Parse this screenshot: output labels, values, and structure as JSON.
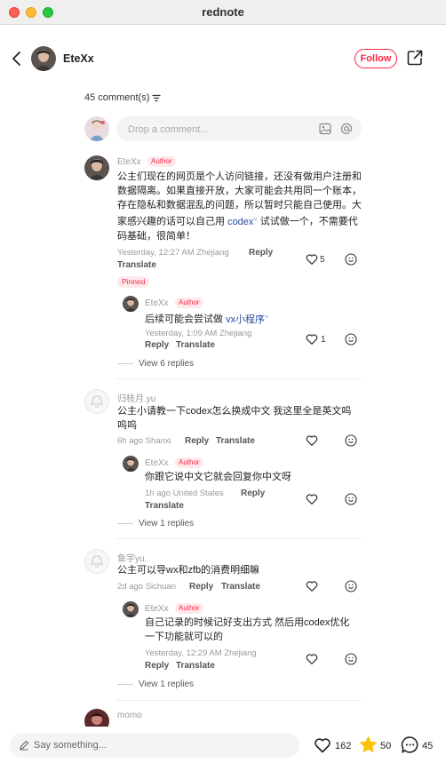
{
  "window": {
    "title": "rednote"
  },
  "nav": {
    "author_name": "EteXx",
    "follow_label": "Follow"
  },
  "comments_header": {
    "count_label": "45 comment(s)",
    "input_placeholder": "Drop a comment..."
  },
  "comments": [
    {
      "user": "EteXx",
      "badge": "Author",
      "text_lines": [
        "公主们现在的网页是个人访问链接，还没有做用户注册和",
        "数据隔离。如果直接开放，大家可能会共用同一个账本，",
        "存在隐私和数据混乱的问题，所以暂时只能自己使用。大",
        "家感兴趣的话可以自己用 ",
        "codex",
        " 试试做一个，不需要代",
        "码基础，很简单！"
      ],
      "meta": "Yesterday, 12:27 AM Zhejiang",
      "reply_label": "Reply",
      "translate_label": "Translate",
      "likes": "5",
      "pinned_label": "Pinned",
      "reply": {
        "user": "EteXx",
        "badge": "Author",
        "text_prefix": "后续可能会尝试做 ",
        "text_tag": "vx小程序",
        "meta": "Yesterday, 1:09 AM Zhejiang",
        "reply_label": "Reply",
        "translate_label": "Translate",
        "likes": "1"
      },
      "view_replies": "View 6 replies"
    },
    {
      "user": "归枝月.yu",
      "text_lines": [
        "公主小请教一下codex怎么换成中文 我这里全是英文呜",
        "呜呜"
      ],
      "meta": "6h ago Shanxi",
      "reply_label": "Reply",
      "translate_label": "Translate",
      "reply": {
        "user": "EteXx",
        "badge": "Author",
        "text": "你跟它说中文它就会回复你中文呀",
        "meta": "1h ago United States",
        "reply_label": "Reply",
        "translate_label": "Translate"
      },
      "view_replies": "View 1 replies"
    },
    {
      "user": "鱼宇yu.",
      "text": "公主可以导wx和zfb的消费明细嘛",
      "meta": "2d ago Sichuan",
      "reply_label": "Reply",
      "translate_label": "Translate",
      "reply": {
        "user": "EteXx",
        "badge": "Author",
        "text_lines": [
          "自己记录的时候记好支出方式 然后用codex优化",
          "一下功能就可以的"
        ],
        "meta": "Yesterday, 12:29 AM Zhejiang",
        "reply_label": "Reply",
        "translate_label": "Translate"
      },
      "view_replies": "View 1 replies"
    },
    {
      "user": "momo"
    }
  ],
  "bottom": {
    "input_placeholder": "Say something...",
    "likes": "162",
    "stars": "50",
    "comments": "45"
  },
  "colors": {
    "accent": "#ff2442",
    "tag": "#2c4aa0",
    "star": "#ffc107"
  }
}
